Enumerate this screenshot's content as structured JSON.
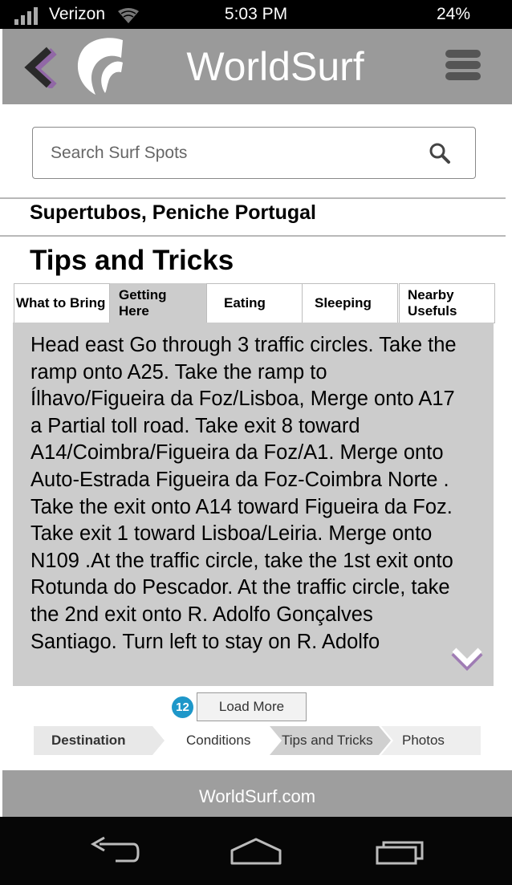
{
  "status_bar": {
    "carrier": "Verizon",
    "time": "5:03 PM",
    "battery": "24%"
  },
  "header": {
    "title": "WorldSurf"
  },
  "search": {
    "placeholder": "Search Surf Spots"
  },
  "location": {
    "title": "Supertubos, Peniche Portugal"
  },
  "section": {
    "title": "Tips and Tricks"
  },
  "tabs": [
    {
      "label": "What to Bring",
      "active": false
    },
    {
      "label": "Getting Here",
      "active": true
    },
    {
      "label": "Eating",
      "active": false
    },
    {
      "label": "Sleeping",
      "active": false
    },
    {
      "label": "Nearby Usefuls",
      "active": false
    }
  ],
  "content": {
    "text": "Head east Go through 3 traffic circles. Take the ramp onto A25. Take the ramp to Ílhavo/Figueira da Foz/Lisboa, Merge onto A17 a Partial toll road. Take exit 8 toward A14/Coimbra/Figueira da Foz/A1. Merge onto Auto-Estrada Figueira da Foz-Coimbra Norte . Take the exit onto A14 toward Figueira da Foz. Take exit 1 toward Lisboa/Leiria. Merge onto N109 .At the traffic circle, take the 1st exit onto Rotunda do Pescador. At the traffic circle, take the 2nd exit onto R. Adolfo Gonçalves Santiago. Turn left to stay on R. Adolfo"
  },
  "load_more": {
    "count": "12",
    "label": "Load More"
  },
  "steps": [
    {
      "label": "Destination",
      "active": false,
      "bold": true
    },
    {
      "label": "Conditions",
      "active": false,
      "bold": false
    },
    {
      "label": "Tips and Tricks",
      "active": true,
      "bold": false
    },
    {
      "label": "Photos",
      "active": false,
      "bold": false
    }
  ],
  "footer": {
    "text": "WorldSurf.com"
  },
  "colors": {
    "header_bg": "#9a9a9a",
    "accent_purple": "#6a2a8a",
    "badge_blue": "#1e97c9",
    "panel_bg": "#cccccc"
  }
}
